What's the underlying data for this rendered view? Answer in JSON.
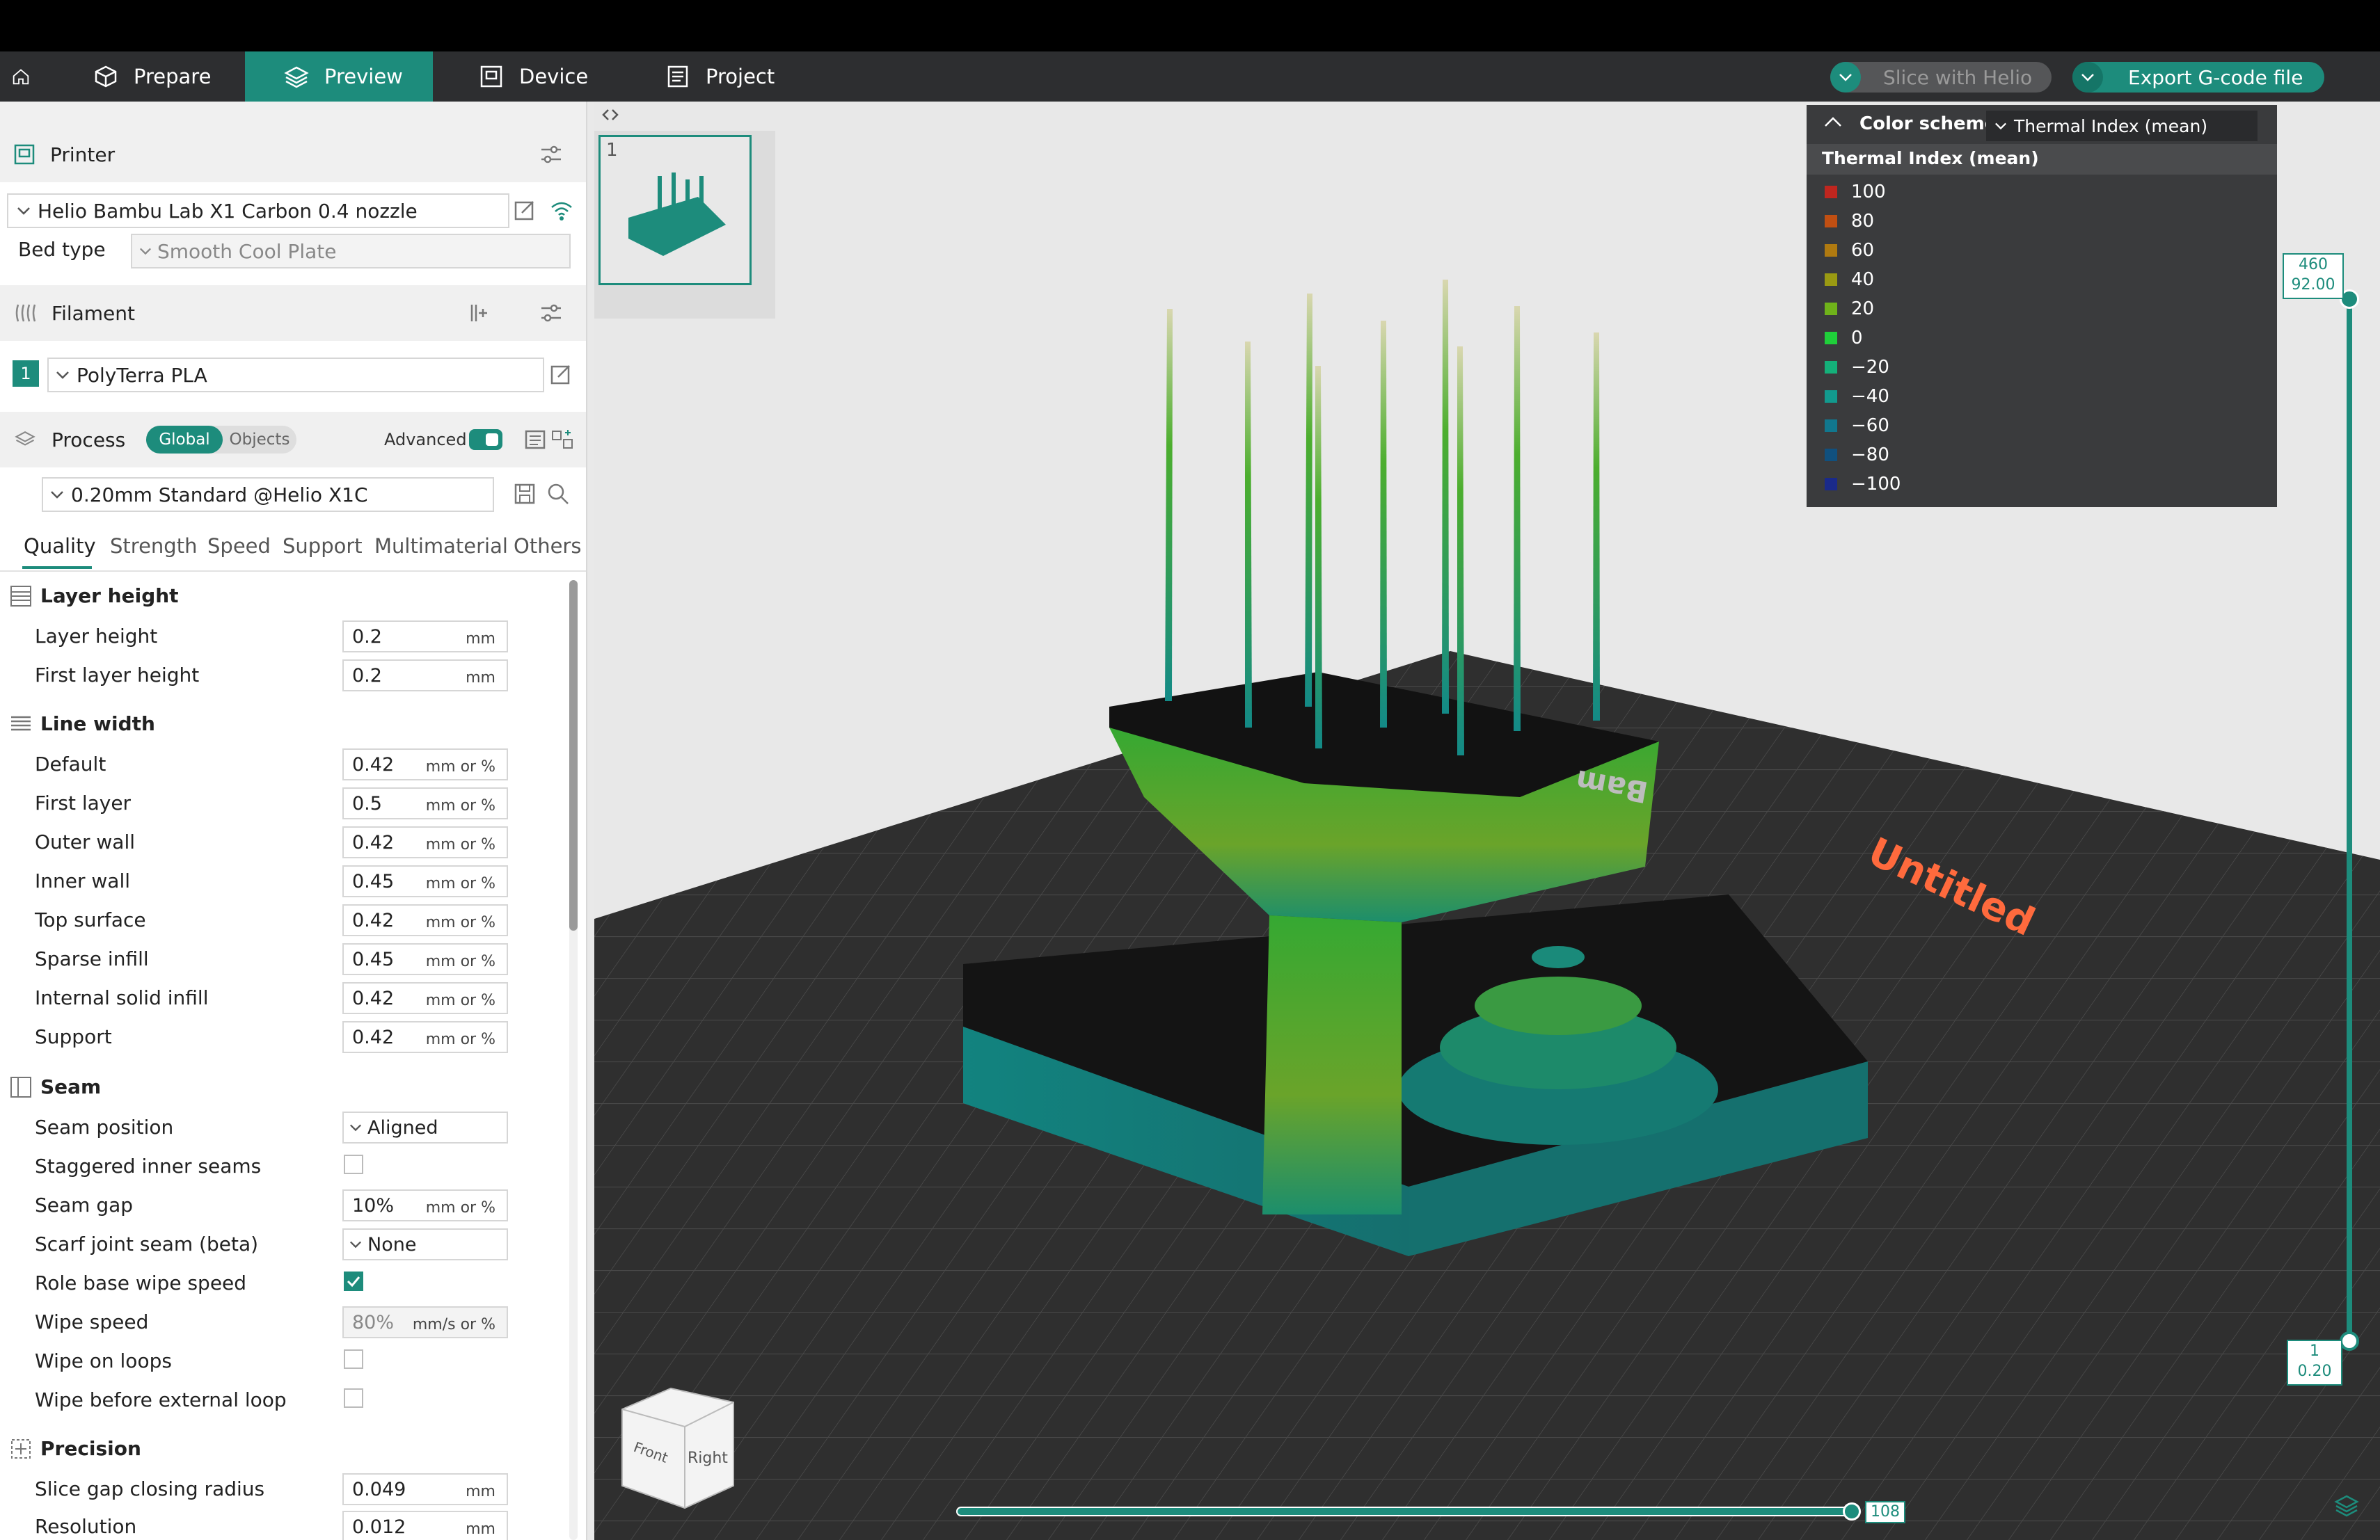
{
  "nav": {
    "tabs": [
      {
        "label": "Prepare"
      },
      {
        "label": "Preview"
      },
      {
        "label": "Device"
      },
      {
        "label": "Project"
      }
    ],
    "slice_button": "Slice with Helio",
    "export_button": "Export G-code file"
  },
  "printer": {
    "title": "Printer",
    "name": "Helio Bambu Lab X1 Carbon 0.4 nozzle",
    "bed_type_label": "Bed type",
    "bed_type_value": "Smooth Cool Plate"
  },
  "filament": {
    "title": "Filament",
    "index": "1",
    "name": "PolyTerra PLA"
  },
  "process": {
    "title": "Process",
    "toggle_global": "Global",
    "toggle_objects": "Objects",
    "advanced_label": "Advanced",
    "profile": "0.20mm Standard @Helio X1C",
    "tabs": [
      "Quality",
      "Strength",
      "Speed",
      "Support",
      "Multimaterial",
      "Others"
    ],
    "groups": {
      "layer_height": {
        "title": "Layer height",
        "rows": [
          {
            "label": "Layer height",
            "value": "0.2",
            "unit": "mm"
          },
          {
            "label": "First layer height",
            "value": "0.2",
            "unit": "mm"
          }
        ]
      },
      "line_width": {
        "title": "Line width",
        "rows": [
          {
            "label": "Default",
            "value": "0.42",
            "unit": "mm or %"
          },
          {
            "label": "First layer",
            "value": "0.5",
            "unit": "mm or %"
          },
          {
            "label": "Outer wall",
            "value": "0.42",
            "unit": "mm or %"
          },
          {
            "label": "Inner wall",
            "value": "0.45",
            "unit": "mm or %"
          },
          {
            "label": "Top surface",
            "value": "0.42",
            "unit": "mm or %"
          },
          {
            "label": "Sparse infill",
            "value": "0.45",
            "unit": "mm or %"
          },
          {
            "label": "Internal solid infill",
            "value": "0.42",
            "unit": "mm or %"
          },
          {
            "label": "Support",
            "value": "0.42",
            "unit": "mm or %"
          }
        ]
      },
      "seam": {
        "title": "Seam",
        "seam_position_label": "Seam position",
        "seam_position_value": "Aligned",
        "staggered_label": "Staggered inner seams",
        "seam_gap_label": "Seam gap",
        "seam_gap_value": "10%",
        "seam_gap_unit": "mm or %",
        "scarf_label": "Scarf joint seam (beta)",
        "scarf_value": "None",
        "role_wipe_label": "Role base wipe speed",
        "wipe_speed_label": "Wipe speed",
        "wipe_speed_value": "80%",
        "wipe_speed_unit": "mm/s or %",
        "wipe_loops_label": "Wipe on loops",
        "wipe_before_label": "Wipe before external loop"
      },
      "precision": {
        "title": "Precision",
        "rows": [
          {
            "label": "Slice gap closing radius",
            "value": "0.049",
            "unit": "mm"
          },
          {
            "label": "Resolution",
            "value": "0.012",
            "unit": "mm"
          }
        ]
      }
    }
  },
  "viewport": {
    "plate_number": "1",
    "plate_label": "Untitled",
    "bed_logo": "Bam",
    "cube_front": "Front",
    "cube_right": "Right",
    "layer_top": "460",
    "layer_top_height": "92.00",
    "layer_bottom": "1",
    "layer_bottom_height": "0.20",
    "move_value": "108"
  },
  "legend": {
    "title": "Color scheme",
    "scheme_value": "Thermal Index (mean)",
    "subtitle": "Thermal Index (mean)",
    "items": [
      {
        "label": "100",
        "color": "#c0261f"
      },
      {
        "label": "80",
        "color": "#c14f12"
      },
      {
        "label": "60",
        "color": "#b07a10"
      },
      {
        "label": "40",
        "color": "#9a9a12"
      },
      {
        "label": "20",
        "color": "#6fb21a"
      },
      {
        "label": "0",
        "color": "#1fcf3a"
      },
      {
        "label": "−20",
        "color": "#14b07a"
      },
      {
        "label": "−40",
        "color": "#129a8e"
      },
      {
        "label": "−60",
        "color": "#11778e"
      },
      {
        "label": "−80",
        "color": "#10507e"
      },
      {
        "label": "−100",
        "color": "#1a2a8a"
      }
    ]
  },
  "colors": {
    "accent": "#1d8c7c",
    "topbar": "#2d2e30",
    "plate_label": "#ff6a3d"
  }
}
